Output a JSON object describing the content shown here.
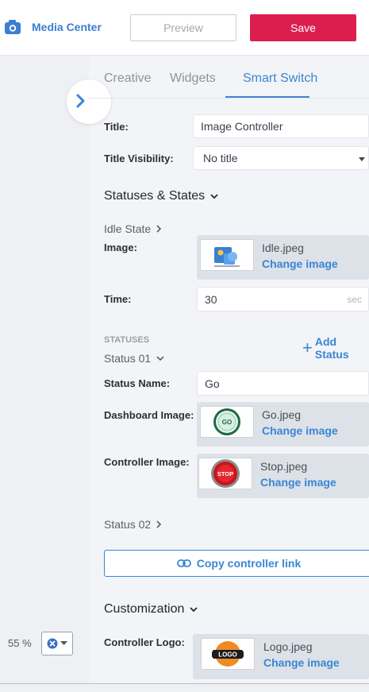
{
  "header": {
    "media_center": "Media Center",
    "preview": "Preview",
    "save": "Save"
  },
  "tabs": [
    "Creative",
    "Widgets",
    "Smart Switch"
  ],
  "form": {
    "title_label": "Title:",
    "title_value": "Image Controller",
    "visibility_label": "Title Visibility:",
    "visibility_value": "No title"
  },
  "statuses_section": {
    "heading": "Statuses & States",
    "idle_state": "Idle State",
    "image_label": "Image:",
    "idle_image": {
      "file": "Idle.jpeg",
      "change": "Change image"
    },
    "time_label": "Time:",
    "time_value": "30",
    "time_unit": "sec",
    "caption": "STATUSES",
    "add_status": "Add Status",
    "status_01": "Status 01",
    "status_name_label": "Status Name:",
    "status_name_value": "Go",
    "dashboard_image_label": "Dashboard Image:",
    "dashboard_image": {
      "file": "Go.jpeg",
      "change": "Change image",
      "badge": "GO"
    },
    "controller_image_label": "Controller Image:",
    "controller_image": {
      "file": "Stop.jpeg",
      "change": "Change image",
      "badge": "STOP"
    },
    "status_02": "Status 02",
    "copy_link": "Copy controller link"
  },
  "customization": {
    "heading": "Customization",
    "logo_label": "Controller Logo:",
    "logo_image": {
      "file": "Logo.jpeg",
      "change": "Change image",
      "badge": "LOGO"
    }
  },
  "footer": {
    "zoom": "55 %"
  },
  "colors": {
    "accent": "#3a86d4",
    "save": "#dc1e4f"
  }
}
